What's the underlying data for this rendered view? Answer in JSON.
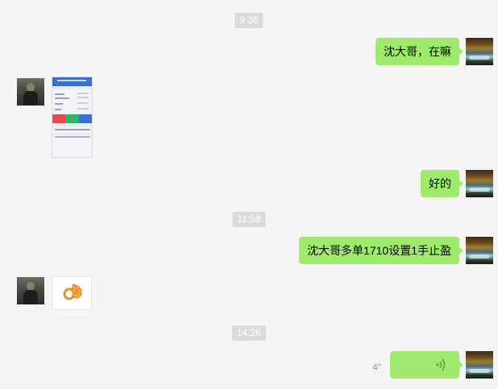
{
  "timestamps": [
    "9:36",
    "11:58",
    "14:26"
  ],
  "messages": [
    {
      "side": "sent",
      "type": "text",
      "text": "沈大哥，在嘛"
    },
    {
      "side": "received",
      "type": "image"
    },
    {
      "side": "sent",
      "type": "text",
      "text": "好的"
    },
    {
      "side": "sent",
      "type": "text",
      "text": "沈大哥多单1710设置1手止盈"
    },
    {
      "side": "received",
      "type": "sticker",
      "icon": "ok-hand-icon"
    },
    {
      "side": "sent",
      "type": "voice",
      "duration": "4\""
    }
  ],
  "colors": {
    "background": "#f5f5f5",
    "sent_bubble": "#9eea6a",
    "timestamp_bg": "#dadada"
  }
}
